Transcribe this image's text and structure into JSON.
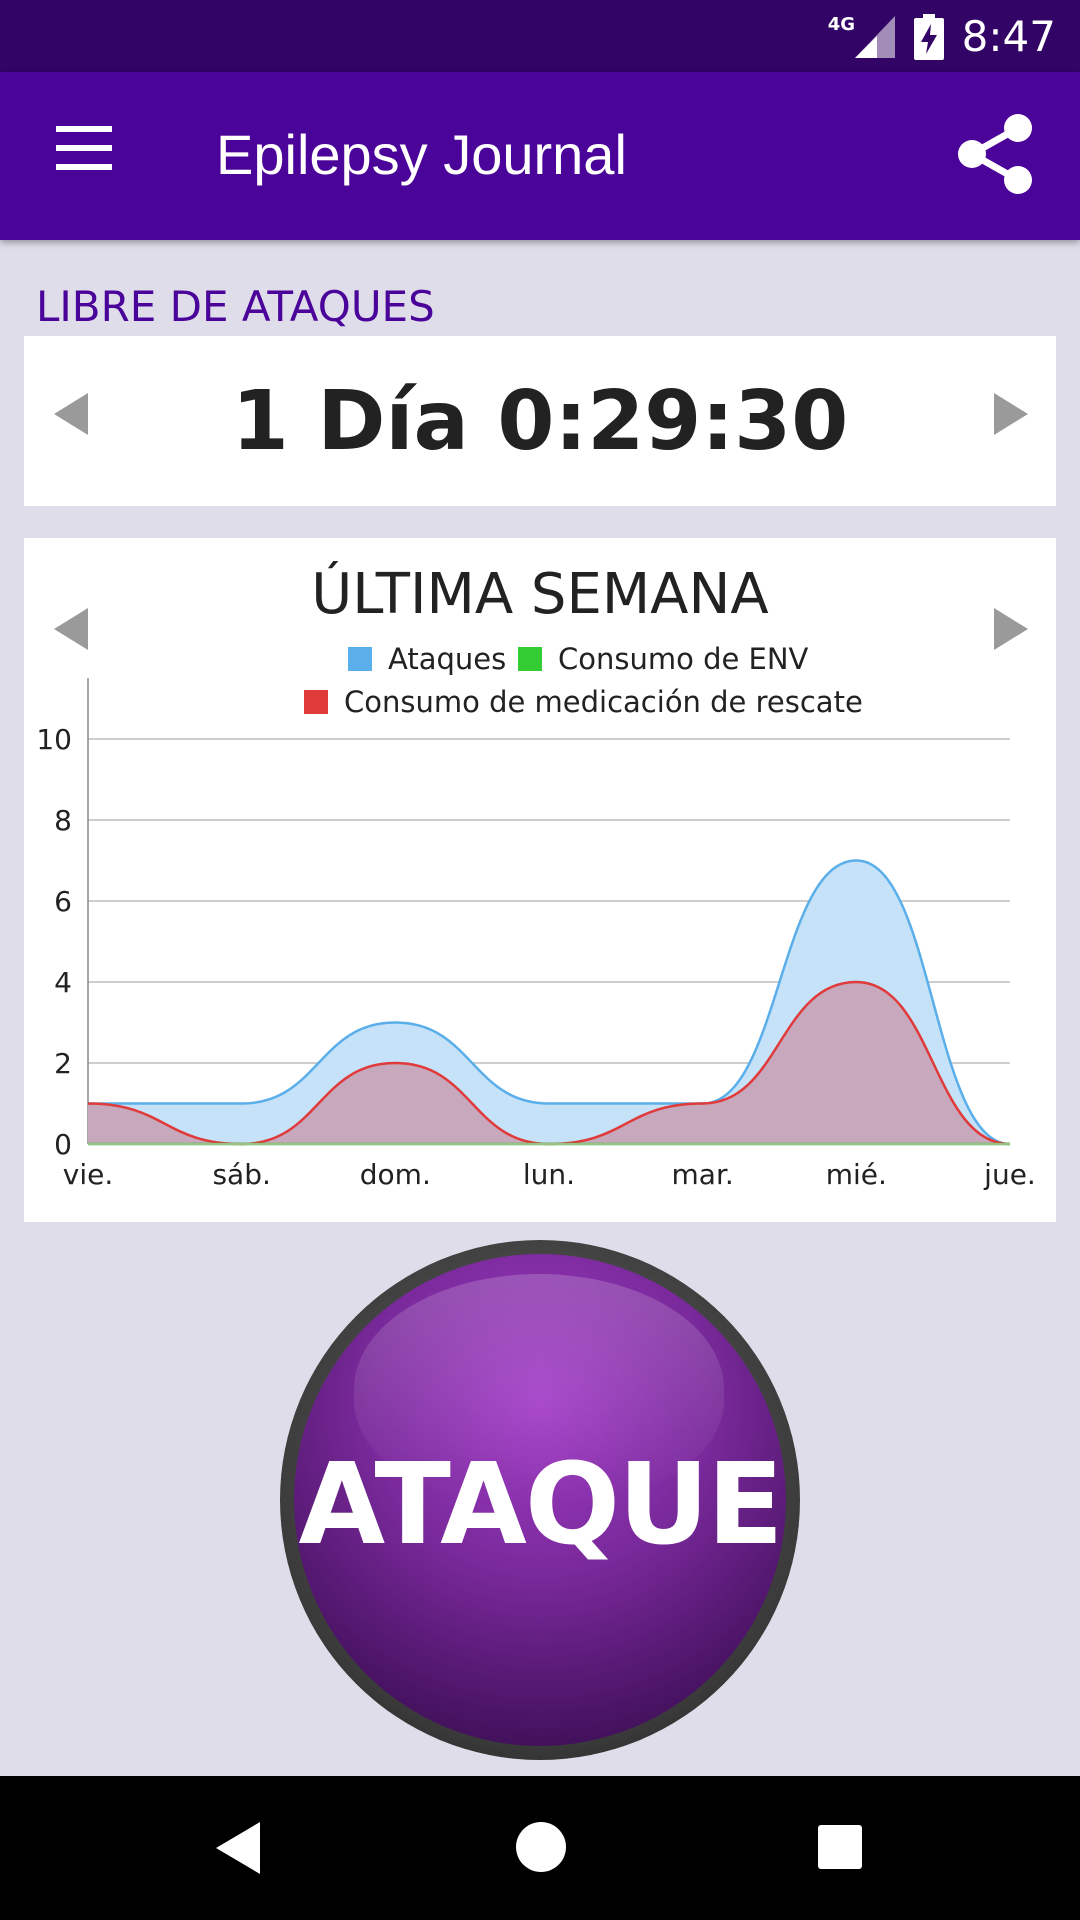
{
  "status_bar": {
    "network": "4G",
    "time": "8:47"
  },
  "app_bar": {
    "title": "Epilepsy Journal",
    "menu_icon": "hamburger-menu-icon",
    "share_icon": "share-icon"
  },
  "seizure_free": {
    "label": "LIBRE DE ATAQUES",
    "value": "1 Día 0:29:30"
  },
  "weekly_chart": {
    "title": "ÚLTIMA SEMANA"
  },
  "chart_data": {
    "type": "area",
    "title": "ÚLTIMA SEMANA",
    "categories": [
      "vie.",
      "sáb.",
      "dom.",
      "lun.",
      "mar.",
      "mié.",
      "jue."
    ],
    "y_ticks": [
      "0",
      "2",
      "4",
      "6",
      "8",
      "10"
    ],
    "ylim": [
      0,
      11.5
    ],
    "grid": true,
    "legend_position": "top",
    "series": [
      {
        "name": "Ataques",
        "color": "#5aaeea",
        "values": [
          1,
          1,
          3,
          1,
          1,
          7,
          0
        ]
      },
      {
        "name": "Consumo de ENV",
        "color": "#33cc33",
        "values": [
          0,
          0,
          0,
          0,
          0,
          0,
          0
        ]
      },
      {
        "name": "Consumo de medicación de rescate",
        "color": "#e03a3a",
        "values": [
          1,
          0,
          2,
          0,
          1,
          4,
          0
        ]
      }
    ]
  },
  "panic_button": {
    "label": "ATAQUE",
    "color": "#7a2a9c"
  },
  "nav_bar": {
    "back_icon": "back-icon",
    "home_icon": "home-icon",
    "recents_icon": "recents-icon"
  }
}
